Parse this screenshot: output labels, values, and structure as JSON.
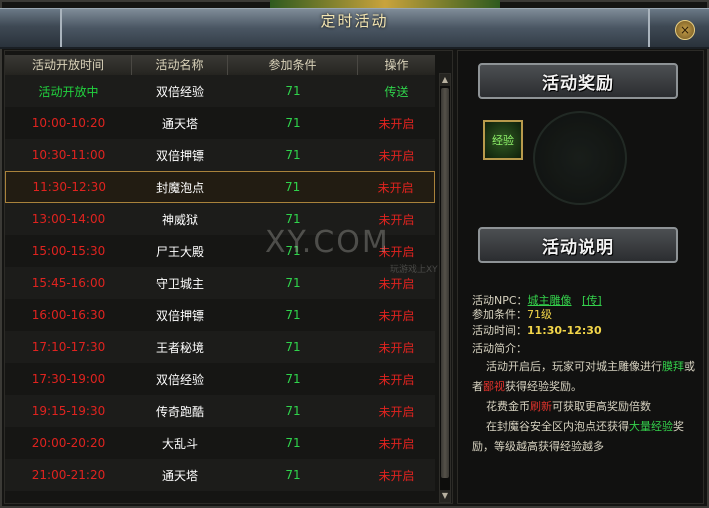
{
  "window": {
    "title": "定时活动",
    "close_label": "×"
  },
  "table": {
    "headers": [
      "活动开放时间",
      "活动名称",
      "参加条件",
      "操作"
    ],
    "rows": [
      {
        "time": "活动开放中",
        "name": "双倍经验",
        "cond": "71",
        "op": "传送",
        "open": true
      },
      {
        "time": "10:00-10:20",
        "name": "通天塔",
        "cond": "71",
        "op": "未开启",
        "open": false
      },
      {
        "time": "10:30-11:00",
        "name": "双倍押镖",
        "cond": "71",
        "op": "未开启",
        "open": false
      },
      {
        "time": "11:30-12:30",
        "name": "封魔泡点",
        "cond": "71",
        "op": "未开启",
        "open": false,
        "selected": true
      },
      {
        "time": "13:00-14:00",
        "name": "神威狱",
        "cond": "71",
        "op": "未开启",
        "open": false
      },
      {
        "time": "15:00-15:30",
        "name": "尸王大殿",
        "cond": "71",
        "op": "未开启",
        "open": false
      },
      {
        "time": "15:45-16:00",
        "name": "守卫城主",
        "cond": "71",
        "op": "未开启",
        "open": false
      },
      {
        "time": "16:00-16:30",
        "name": "双倍押镖",
        "cond": "71",
        "op": "未开启",
        "open": false
      },
      {
        "time": "17:10-17:30",
        "name": "王者秘境",
        "cond": "71",
        "op": "未开启",
        "open": false
      },
      {
        "time": "17:30-19:00",
        "name": "双倍经验",
        "cond": "71",
        "op": "未开启",
        "open": false
      },
      {
        "time": "19:15-19:30",
        "name": "传奇跑酷",
        "cond": "71",
        "op": "未开启",
        "open": false
      },
      {
        "time": "20:00-20:20",
        "name": "大乱斗",
        "cond": "71",
        "op": "未开启",
        "open": false
      },
      {
        "time": "21:00-21:20",
        "name": "通天塔",
        "cond": "71",
        "op": "未开启",
        "open": false
      }
    ]
  },
  "rewards": {
    "banner": "活动奖励",
    "item_label": "经验"
  },
  "info": {
    "banner": "活动说明",
    "npc_label": "活动NPC：",
    "npc_name": "城主雕像",
    "npc_teleport": "[传]",
    "cond_label": "参加条件：",
    "cond_value": "71级",
    "time_label": "活动时间：",
    "time_value": "11:30-12:30",
    "intro_label": "活动简介：",
    "p1_a": "活动开启后，玩家可对城主雕像进行",
    "p1_b": "膜拜",
    "p1_c": "或者",
    "p1_d": "鄙视",
    "p1_e": "获得经验奖励。",
    "p2_a": "花费金币",
    "p2_b": "刷新",
    "p2_c": "可获取更高奖励倍数",
    "p3_a": "在封魔谷安全区内泡点还获得",
    "p3_b": "大量经验",
    "p3_c": "奖励，等级越高获得经验越多"
  },
  "watermark": {
    "text": "XY.COM",
    "sub": "玩游戏上XY"
  },
  "colors": {
    "open_green": "#21d23e",
    "closed_red": "#e0231f",
    "select_border": "#a9823b"
  }
}
